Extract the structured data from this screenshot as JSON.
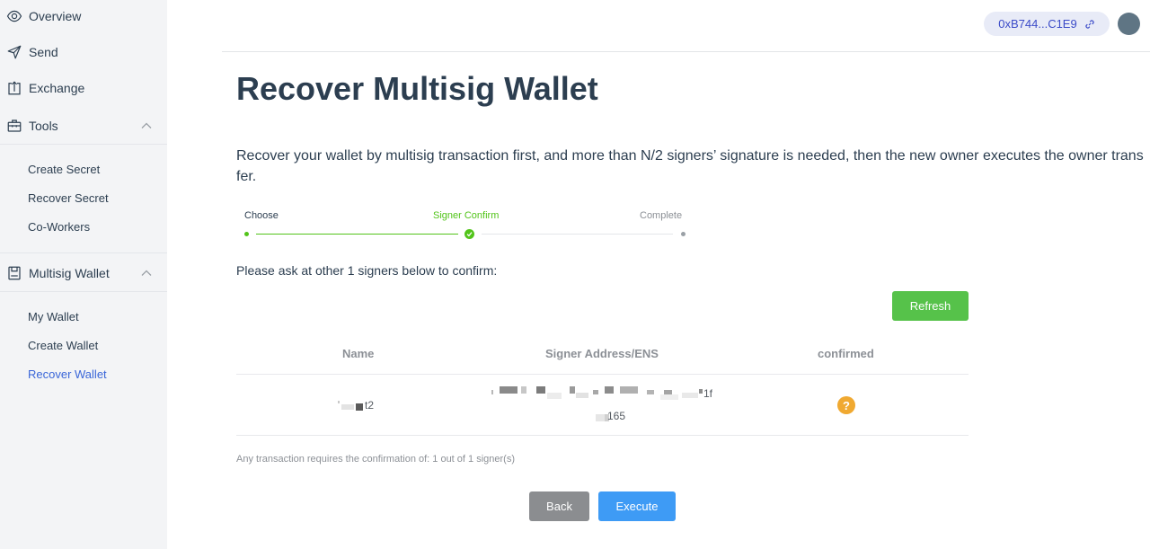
{
  "sidebar": {
    "overview": "Overview",
    "send": "Send",
    "exchange": "Exchange",
    "tools": {
      "label": "Tools",
      "items": [
        "Create Secret",
        "Recover Secret",
        "Co-Workers"
      ]
    },
    "multisig": {
      "label": "Multisig Wallet",
      "items": [
        "My Wallet",
        "Create Wallet",
        "Recover Wallet"
      ]
    },
    "active_color": "#3a66d8"
  },
  "header": {
    "account": "0xB744...C1E9"
  },
  "page": {
    "title": "Recover Multisig Wallet",
    "description": "Recover your wallet by multisig transaction first, and more than N/2 signers’ signature is needed, then the new owner executes the owner transfer.",
    "steps": [
      "Choose",
      "Signer Confirm",
      "Complete"
    ],
    "prompt": "Please ask at other 1 signers below to confirm:",
    "refresh_label": "Refresh",
    "table": {
      "headers": [
        "Name",
        "Signer Address/ENS",
        "confirmed"
      ],
      "rows": [
        {
          "name_visible": "t2",
          "address_line1_visible": "1f",
          "address_line2_visible": "165",
          "confirmed_icon": "question-icon"
        }
      ]
    },
    "note": "Any transaction requires the confirmation of: 1 out of 1 signer(s)",
    "back_label": "Back",
    "execute_label": "Execute"
  },
  "colors": {
    "success": "#56c24a",
    "primary": "#3e9bf5",
    "warning": "#f0a931",
    "muted_button": "#8b8d90"
  }
}
